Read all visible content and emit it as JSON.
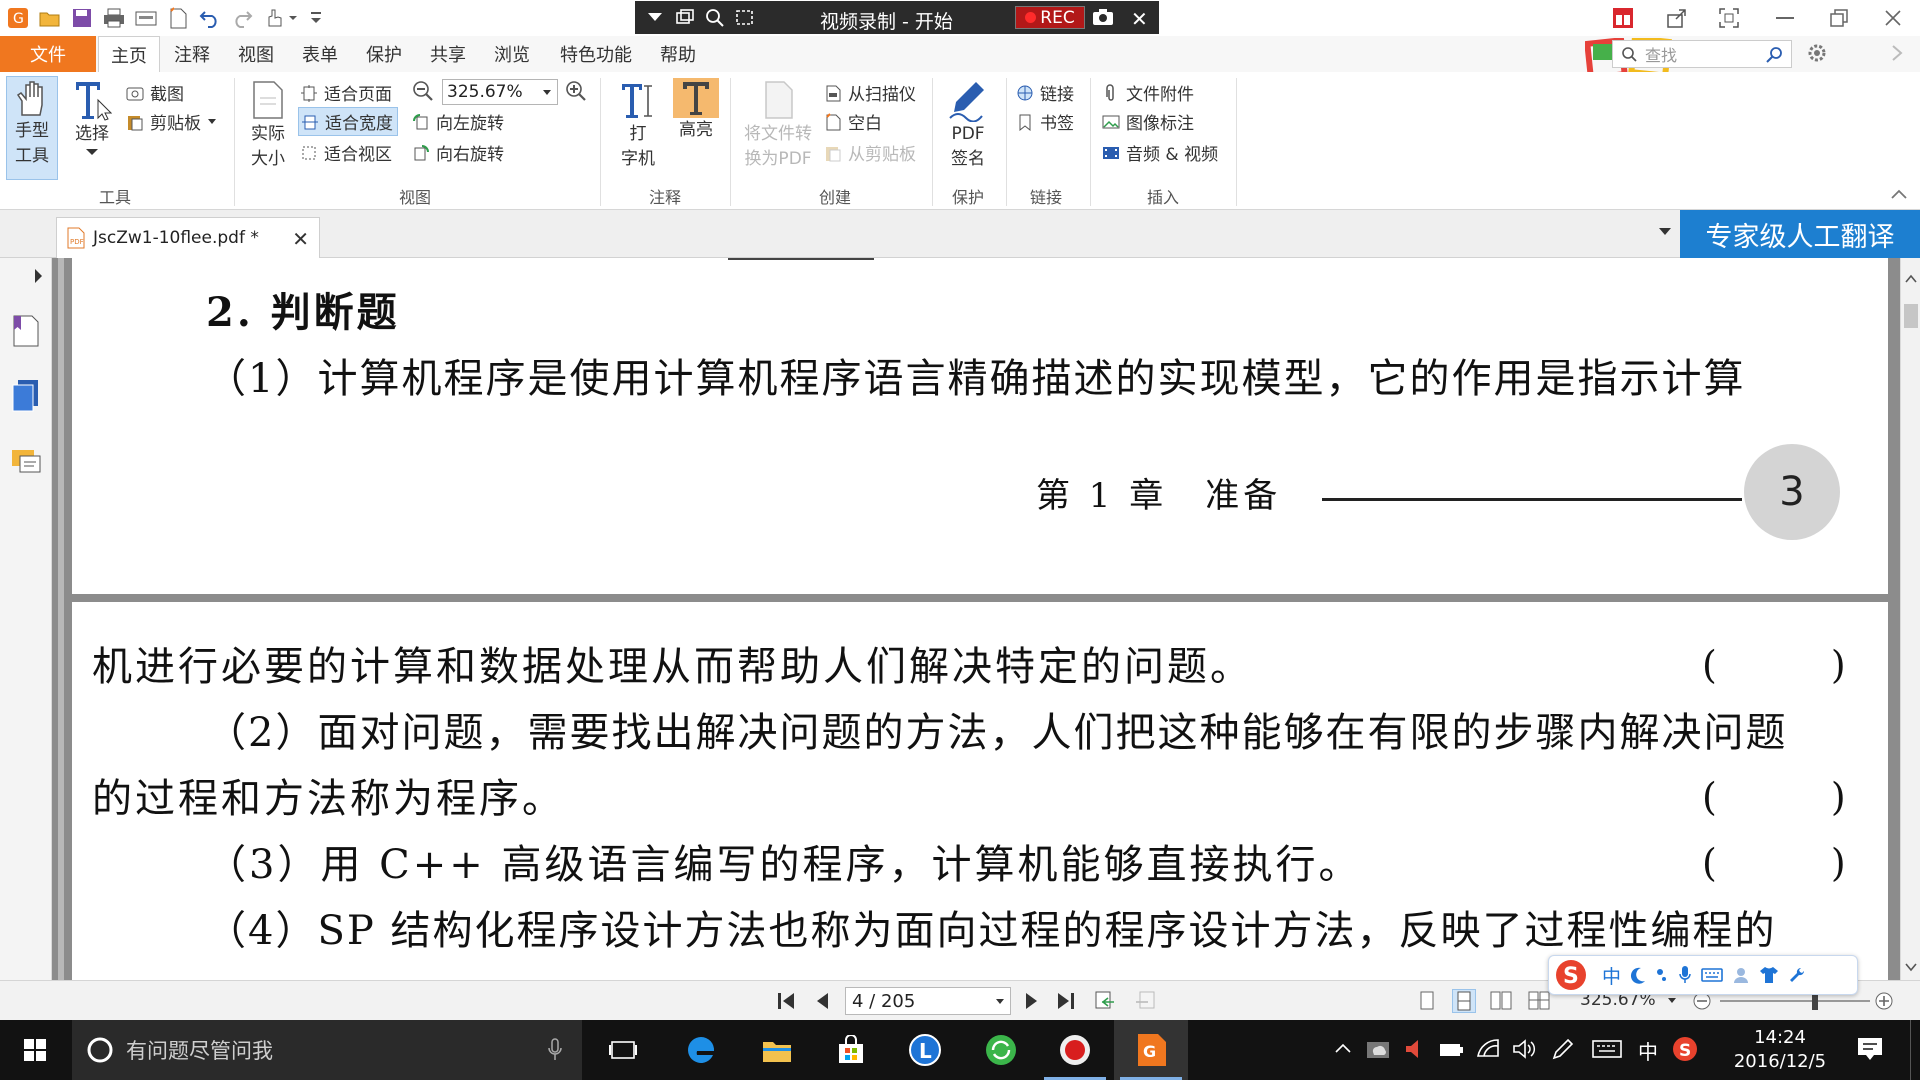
{
  "titlebar": {
    "recorder_title": "视频录制 - 开始",
    "rec_label": "REC"
  },
  "menu": {
    "items": [
      "文件",
      "主页",
      "注释",
      "视图",
      "表单",
      "保护",
      "共享",
      "浏览",
      "特色功能",
      "帮助"
    ],
    "active": "主页",
    "search_placeholder": "查找"
  },
  "ribbon": {
    "tools": {
      "hand_line1": "手型",
      "hand_line2": "工具",
      "select": "选择",
      "screenshot": "截图",
      "clipboard": "剪贴板",
      "group": "工具"
    },
    "view": {
      "actual_line1": "实际",
      "actual_line2": "大小",
      "fit_page": "适合页面",
      "fit_width": "适合宽度",
      "fit_visible": "适合视区",
      "zoom_value": "325.67%",
      "rotate_left": "向左旋转",
      "rotate_right": "向右旋转",
      "group": "视图"
    },
    "comment": {
      "typewriter_line1": "打",
      "typewriter_line2": "字机",
      "highlight": "高亮",
      "group": "注释"
    },
    "create": {
      "convert_line1": "将文件转",
      "convert_line2": "换为PDF",
      "from_scanner": "从扫描仪",
      "blank": "空白",
      "from_clipboard": "从剪贴板",
      "group": "创建"
    },
    "protect": {
      "sign_line1": "PDF",
      "sign_line2": "签名",
      "group": "保护"
    },
    "links": {
      "link": "链接",
      "bookmark": "书签",
      "group": "链接"
    },
    "insert": {
      "attachment": "文件附件",
      "image_annot": "图像标注",
      "audio_video": "音频 & 视频",
      "group": "插入"
    }
  },
  "tabs": {
    "document": "JscZw1-10flee.pdf *",
    "translate": "专家级人工翻译"
  },
  "page_top": {
    "section_heading": "2. 判断题",
    "q1_line1": "（1）计算机程序是使用计算机程序语言精确描述的实现模型，它的作用是指示计算",
    "footer_chapter": "第 1 章　准备",
    "page_number": "3"
  },
  "page_bottom": {
    "lines": [
      "机进行必要的计算和数据处理从而帮助人们解决特定的问题。",
      "（2）面对问题，需要找出解决问题的方法，人们把这种能够在有限的步骤内解决问题",
      "的过程和方法称为程序。",
      "（3）用 C++ 高级语言编写的程序，计算机能够直接执行。",
      "（4）SP 结构化程序设计方法也称为面向过程的程序设计方法，反映了过程性编程的"
    ],
    "answer_blank": "(　　　)"
  },
  "status": {
    "page_indicator": "4 / 205",
    "zoom": "325.67%"
  },
  "taskbar": {
    "search_placeholder": "有问题尽管问我",
    "time": "14:24",
    "date": "2016/12/5",
    "ime_lang": "中"
  },
  "colors": {
    "accent_orange": "#f0771f",
    "translate_blue": "#1d7fd0",
    "rec_red": "#b21818"
  }
}
